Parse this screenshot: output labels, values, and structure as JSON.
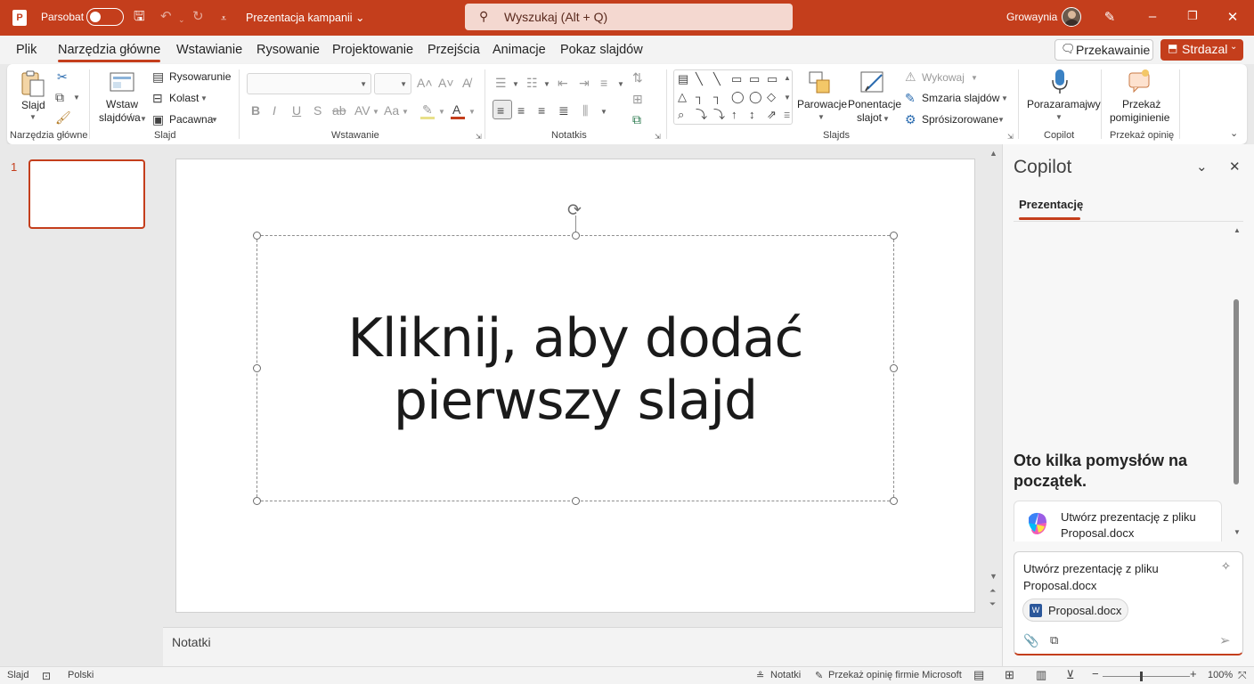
{
  "titlebar": {
    "autosave_label": "Parsobat",
    "doc_title": "Prezentacja kampanii",
    "doc_title_caret": "⌄",
    "search_placeholder": "Wyszukaj (Alt + Q)",
    "user_name": "Growaynia"
  },
  "menu": {
    "tabs": [
      "Plik",
      "Narzędzia główne",
      "Wstawianie",
      "Rysowanie",
      "Projektowanie",
      "Przejścia",
      "Animacje",
      "Pokaz slajdów"
    ],
    "active_tab": "Narzędzia główne",
    "share_label": "Przekawainie",
    "present_label": "Strdazal"
  },
  "ribbon": {
    "slide_label": "Slajd",
    "new_slide_label_1": "Wstaw",
    "new_slide_label_2": "slajdóẃa",
    "layout_label": "Rysowarunie",
    "reset_label": "Kolast",
    "section_label": "Pacawna",
    "bold": "B",
    "italic": "I",
    "underline": "U",
    "shadow": "S",
    "case": "Aa",
    "grow_font": "A˄",
    "shrink_font": "A˅",
    "arrange_label": "Parowacje",
    "quick_styles_label_1": "Ponentacje",
    "quick_styles_label_2": "slajot",
    "fill_label": "Wykowaj",
    "smart_label": "Smzaria slajdów",
    "select_label": "Sprósizorowane",
    "dictate_label": "Porazaramajwy",
    "feedback_label_1": "Przekaż",
    "feedback_label_2": "pomiginienie",
    "groups": [
      "Narzędzia główne",
      "Slajd",
      "Wstawanie",
      "Notatkis",
      "Slajds",
      "Copilot",
      "Przekaż opinię"
    ]
  },
  "slides": {
    "number": "1",
    "title_placeholder": "Kliknij, aby dodać\npierwszy slajd"
  },
  "notes": {
    "label": "Notatki"
  },
  "copilot": {
    "title": "Copilot",
    "tab": "Prezentację",
    "heading": "Oto kilka pomysłów na początek.",
    "suggestion": "Utwórz prezentację z pliku Proposal.docx",
    "prompt": "Utwórz prezentację z pliku Proposal.docx",
    "attachment": "Proposal.docx"
  },
  "status": {
    "slide": "Slajd",
    "language": "Polski",
    "notes": "Notatki",
    "feedback": "Przekaż opinię firmie Microsoft",
    "zoom": "100%"
  },
  "colors": {
    "accent": "#c43e1c",
    "search_bg": "#f4d8d0"
  }
}
